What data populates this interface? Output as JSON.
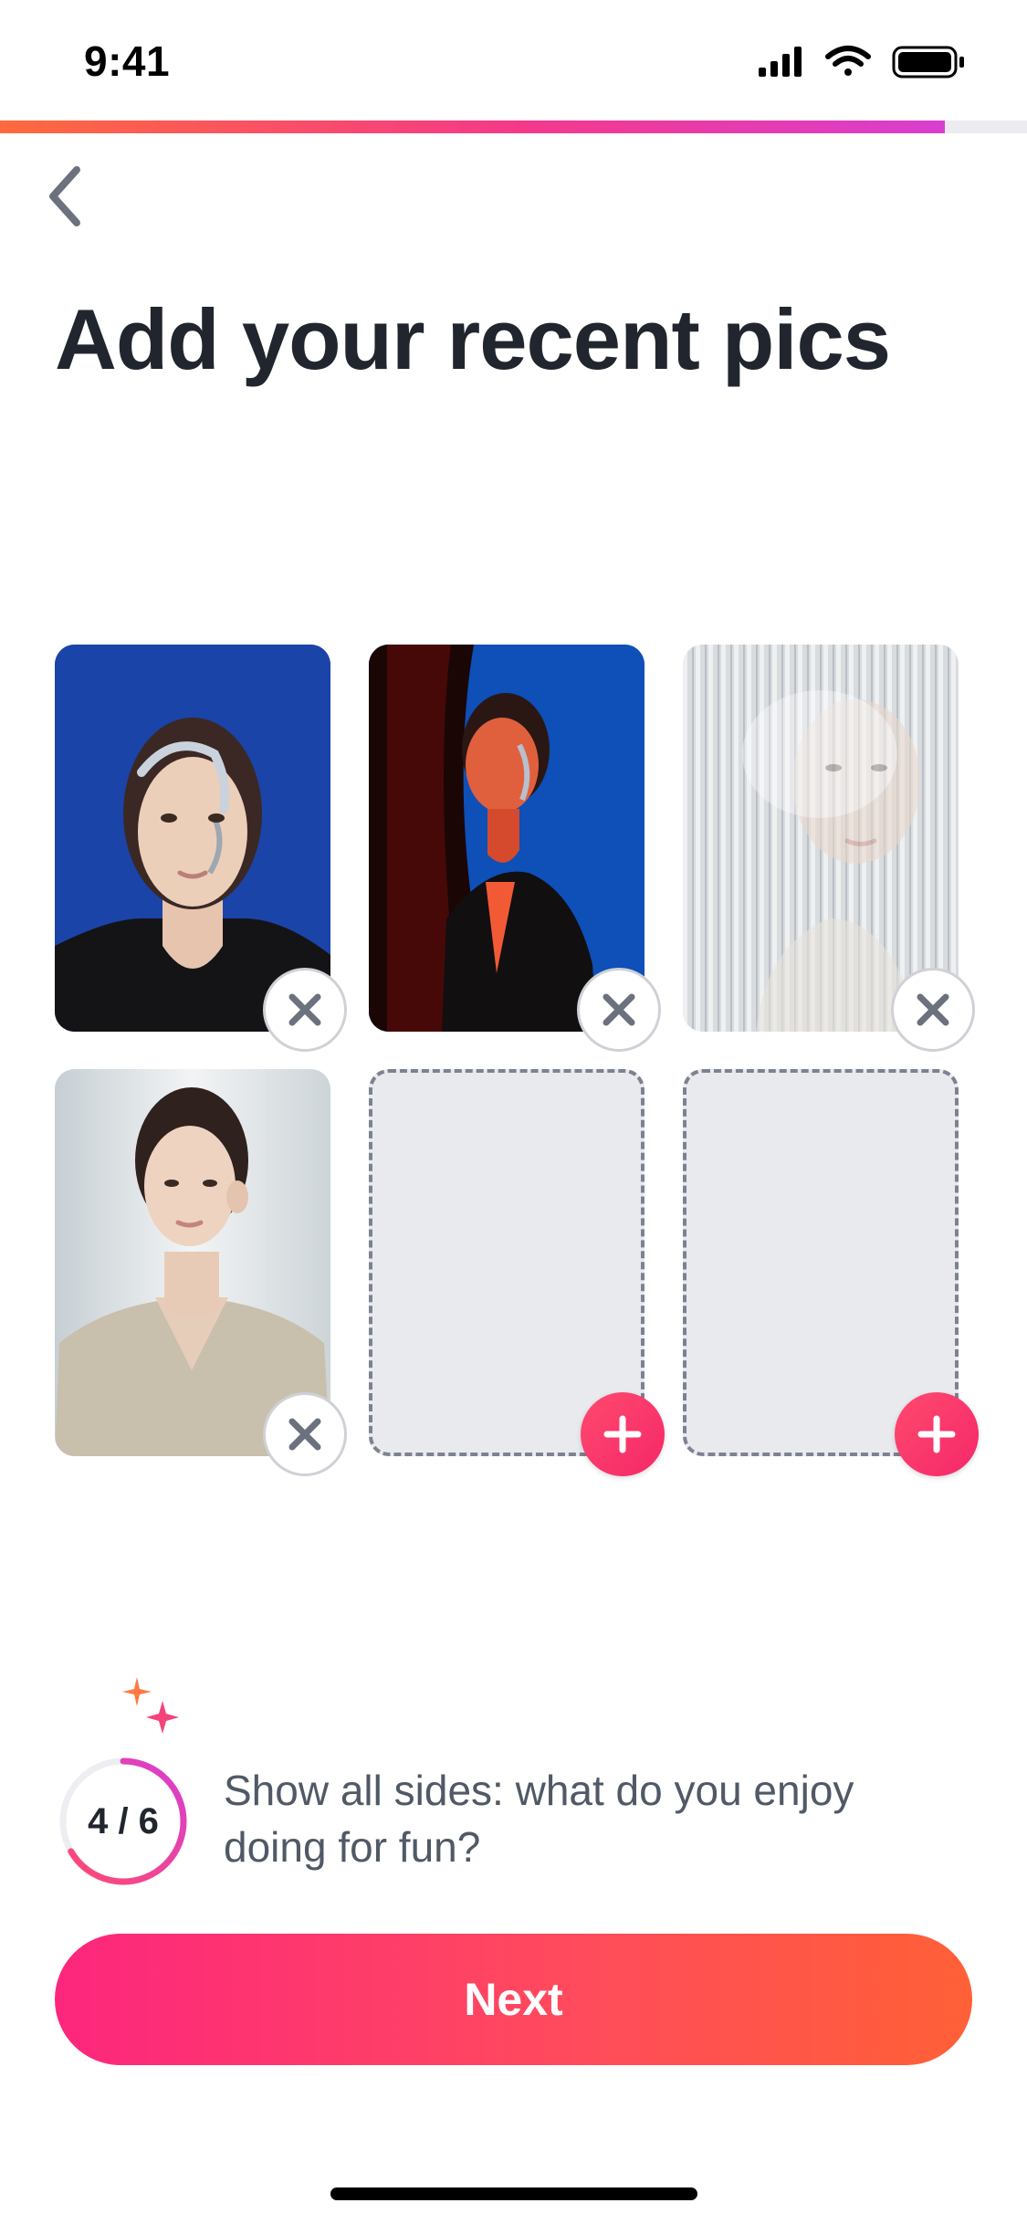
{
  "status_bar": {
    "time": "9:41",
    "icons": [
      "signal-icon",
      "wifi-icon",
      "battery-icon"
    ]
  },
  "progress": {
    "fraction": 0.92,
    "colors": [
      "#ff6a3d",
      "#f4398a",
      "#d93ed0"
    ]
  },
  "header": {
    "back_icon": "chevron-left-icon"
  },
  "title": "Add your recent pics",
  "photos": [
    {
      "state": "filled",
      "action_icon": "close-icon"
    },
    {
      "state": "filled",
      "action_icon": "close-icon"
    },
    {
      "state": "filled",
      "action_icon": "close-icon"
    },
    {
      "state": "filled",
      "action_icon": "close-icon"
    },
    {
      "state": "empty",
      "action_icon": "plus-icon"
    },
    {
      "state": "empty",
      "action_icon": "plus-icon"
    }
  ],
  "tip": {
    "counter": "4 / 6",
    "fraction": 0.6667,
    "text": "Show all sides: what do you enjoy doing for fun?",
    "sparkle_icon": "sparkle-icon"
  },
  "cta": {
    "label": "Next"
  },
  "colors": {
    "accent": "#fd267d",
    "accent_end": "#ff6036",
    "text": "#21262e",
    "muted": "#505965"
  }
}
